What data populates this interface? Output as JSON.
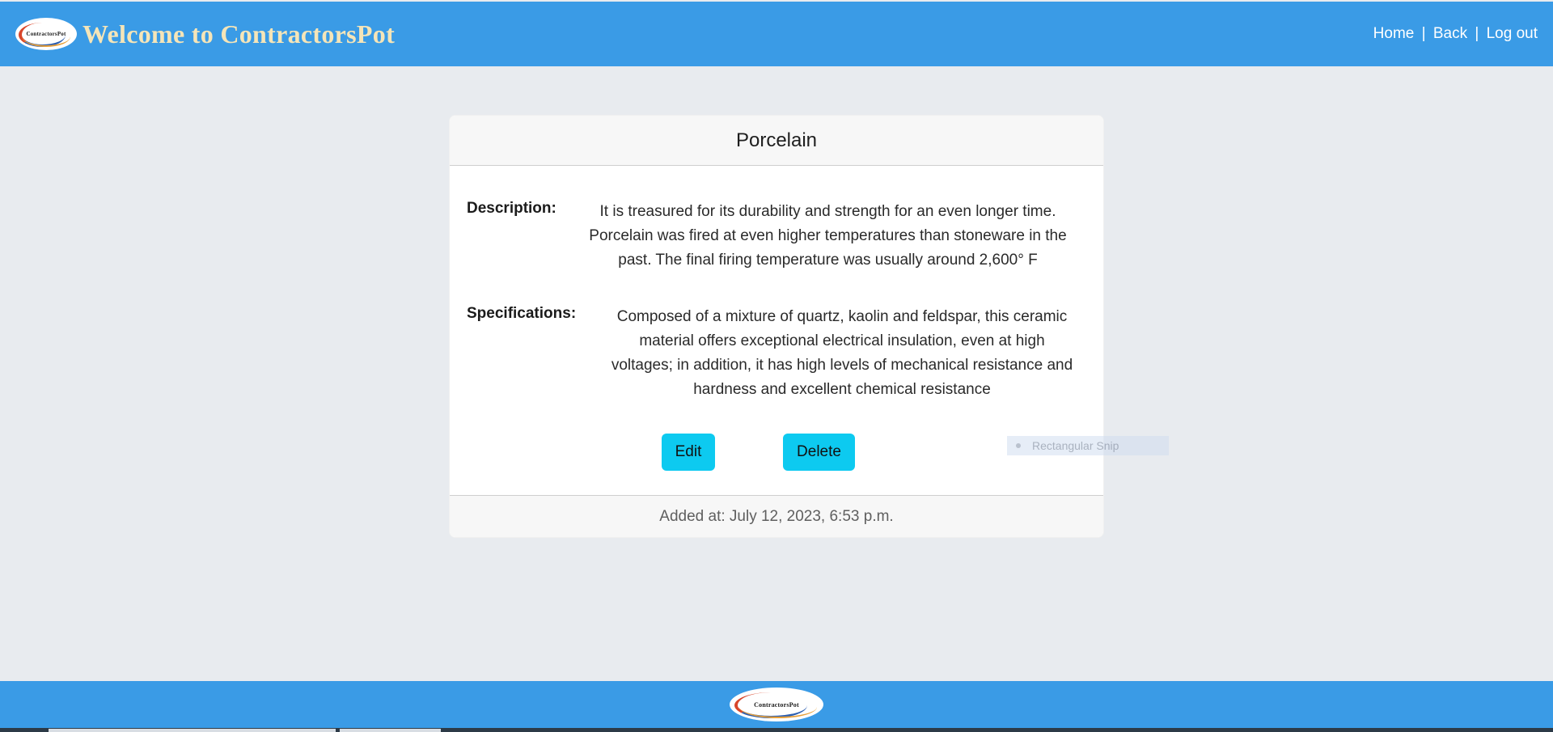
{
  "header": {
    "logo_text": "ContractorsPot",
    "title": "Welcome to ContractorsPot",
    "nav": {
      "home": "Home",
      "back": "Back",
      "logout": "Log out",
      "separator": "|"
    }
  },
  "card": {
    "title": "Porcelain",
    "description_label": "Description:",
    "description_lines": [
      "It is treasured for its durability and strength for an even longer time.",
      "Porcelain was fired at even higher temperatures than stoneware in the",
      "past. The final firing temperature was usually around 2,600° F"
    ],
    "specifications_label": "Specifications:",
    "specifications_lines": [
      "Composed of a mixture of quartz, kaolin and feldspar, this ceramic",
      "material offers exceptional electrical insulation, even at high",
      "voltages; in addition, it has high levels of mechanical resistance and",
      "hardness and excellent chemical resistance"
    ],
    "edit_label": "Edit",
    "delete_label": "Delete",
    "added_at": "Added at: July 12, 2023, 6:53 p.m."
  },
  "overlay": {
    "snip_label": "Rectangular Snip"
  },
  "footer": {
    "logo_text": "ContractorsPot"
  },
  "colors": {
    "navbar": "#3a9be6",
    "title_text": "#f5e5b8",
    "button": "#0dcaf0",
    "background": "#e8ebef"
  }
}
